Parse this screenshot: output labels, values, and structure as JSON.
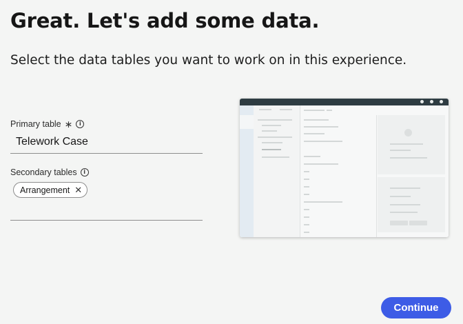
{
  "header": {
    "title": "Great. Let's add some data.",
    "subtitle": "Select the data tables you want to work on in this experience."
  },
  "form": {
    "primary_label": "Primary table",
    "required_mark": "∗",
    "primary_value": "Telework Case",
    "secondary_label": "Secondary tables",
    "chips": [
      "Arrangement"
    ],
    "chip_remove": "✕",
    "info_glyph": "i"
  },
  "footer": {
    "continue_label": "Continue"
  },
  "colors": {
    "accent": "#3d5ce6",
    "background": "#f4f5f4",
    "preview_header": "#2e3c42"
  },
  "icons": {
    "required": "asterisk-icon",
    "info": "info-icon",
    "remove": "close-icon",
    "preview_illustration": "workspace-preview-illustration"
  }
}
